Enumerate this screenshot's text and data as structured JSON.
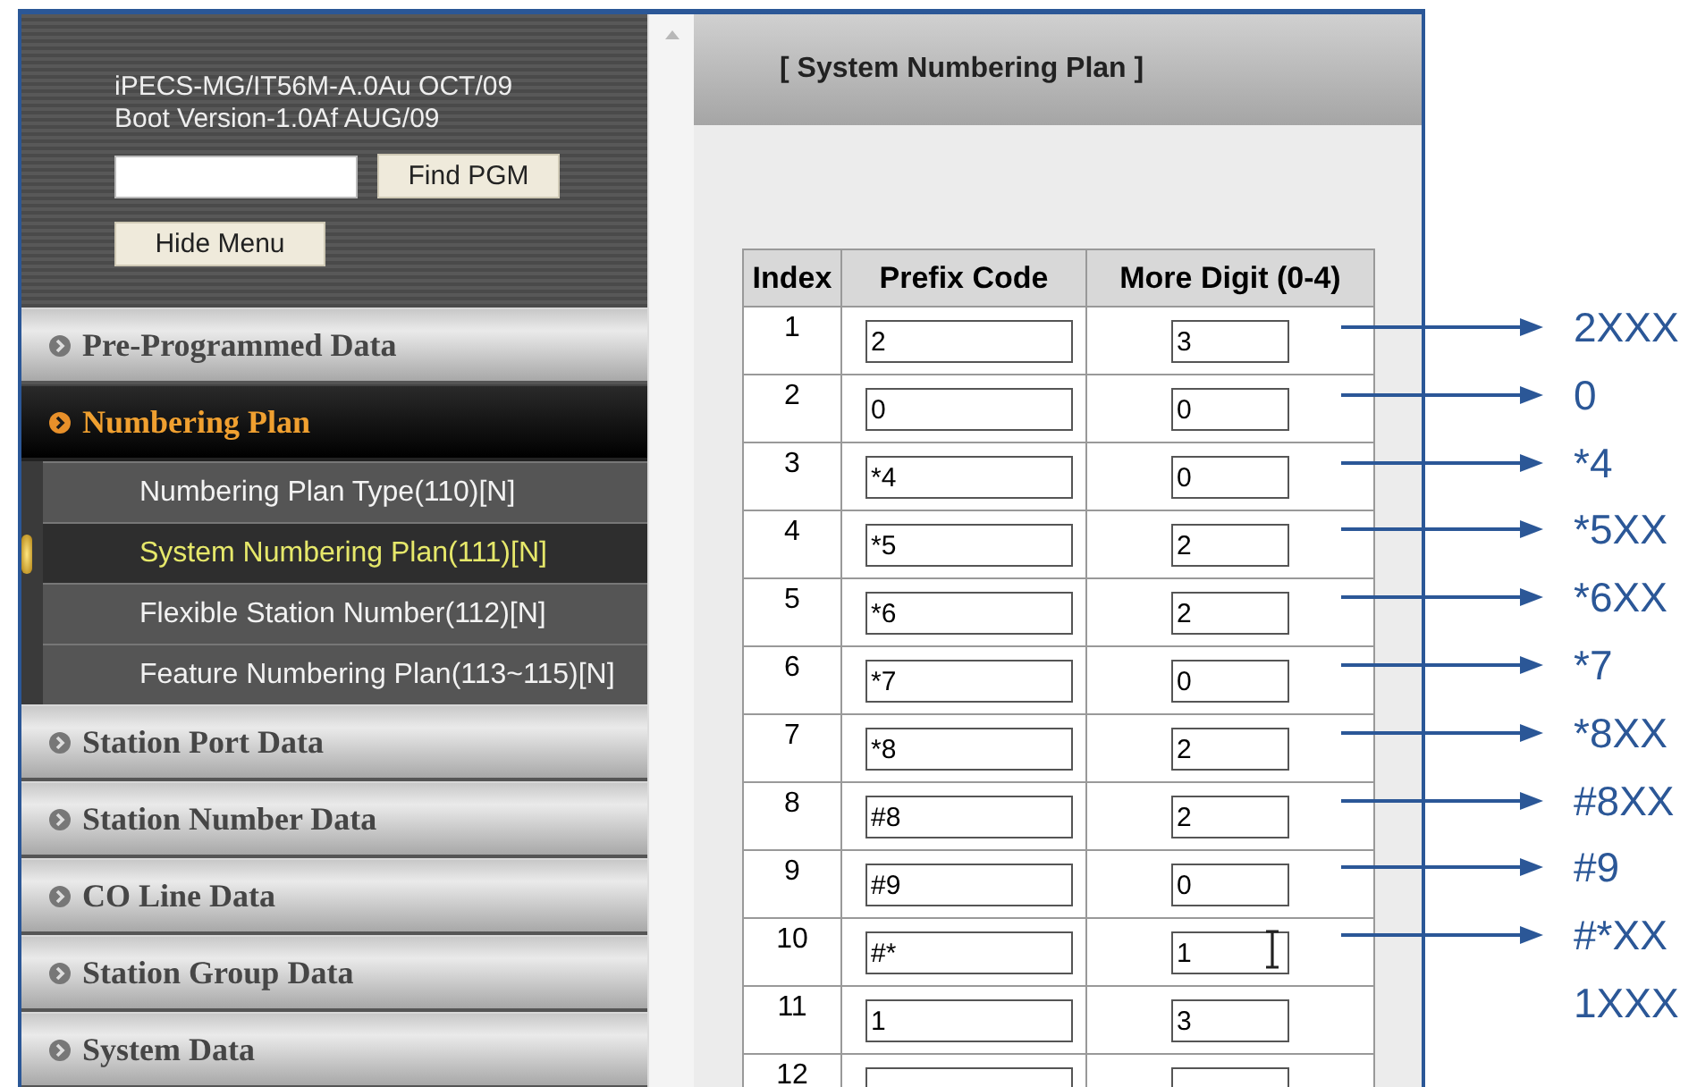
{
  "sidebar": {
    "version_lines": [
      "iPECS-MG/IT56M-A.0Au OCT/09",
      "Boot Version-1.0Af AUG/09"
    ],
    "find_button": "Find PGM",
    "hide_button": "Hide Menu",
    "menu": [
      {
        "label": "Pre-Programmed Data",
        "expanded": false
      },
      {
        "label": "Numbering Plan",
        "expanded": true,
        "children": [
          {
            "label": "Numbering Plan Type(110)[N]",
            "selected": false
          },
          {
            "label": "System Numbering Plan(111)[N]",
            "selected": true
          },
          {
            "label": "Flexible Station Number(112)[N]",
            "selected": false
          },
          {
            "label": "Feature Numbering Plan(113~115)[N]",
            "selected": false
          }
        ]
      },
      {
        "label": "Station Port Data",
        "expanded": false
      },
      {
        "label": "Station Number Data",
        "expanded": false
      },
      {
        "label": "CO Line Data",
        "expanded": false
      },
      {
        "label": "Station Group Data",
        "expanded": false
      },
      {
        "label": "System Data",
        "expanded": false
      }
    ]
  },
  "main": {
    "title": "[ System Numbering Plan ]",
    "table": {
      "columns": [
        "Index",
        "Prefix Code",
        "More Digit (0-4)"
      ],
      "rows": [
        {
          "index": "1",
          "prefix": "2",
          "digits": "3",
          "cursor": false
        },
        {
          "index": "2",
          "prefix": "0",
          "digits": "0",
          "cursor": false
        },
        {
          "index": "3",
          "prefix": "*4",
          "digits": "0",
          "cursor": false
        },
        {
          "index": "4",
          "prefix": "*5",
          "digits": "2",
          "cursor": false
        },
        {
          "index": "5",
          "prefix": "*6",
          "digits": "2",
          "cursor": false
        },
        {
          "index": "6",
          "prefix": "*7",
          "digits": "0",
          "cursor": false
        },
        {
          "index": "7",
          "prefix": "*8",
          "digits": "2",
          "cursor": false
        },
        {
          "index": "8",
          "prefix": "#8",
          "digits": "2",
          "cursor": false
        },
        {
          "index": "9",
          "prefix": "#9",
          "digits": "0",
          "cursor": false
        },
        {
          "index": "10",
          "prefix": "#*",
          "digits": "1",
          "cursor": true
        },
        {
          "index": "11",
          "prefix": "1",
          "digits": "3",
          "cursor": false
        },
        {
          "index": "12",
          "cursor": false
        }
      ]
    }
  },
  "annotations": [
    {
      "label": "2XXX",
      "arrow": true
    },
    {
      "label": "0",
      "arrow": true
    },
    {
      "label": "*4",
      "arrow": true
    },
    {
      "label": "*5XX",
      "arrow": true
    },
    {
      "label": "*6XX",
      "arrow": true
    },
    {
      "label": "*7",
      "arrow": true
    },
    {
      "label": "*8XX",
      "arrow": true
    },
    {
      "label": "#8XX",
      "arrow": true
    },
    {
      "label": "#9",
      "arrow": true
    },
    {
      "label": "#*XX",
      "arrow": true
    },
    {
      "label": "1XXX",
      "arrow": false
    }
  ]
}
